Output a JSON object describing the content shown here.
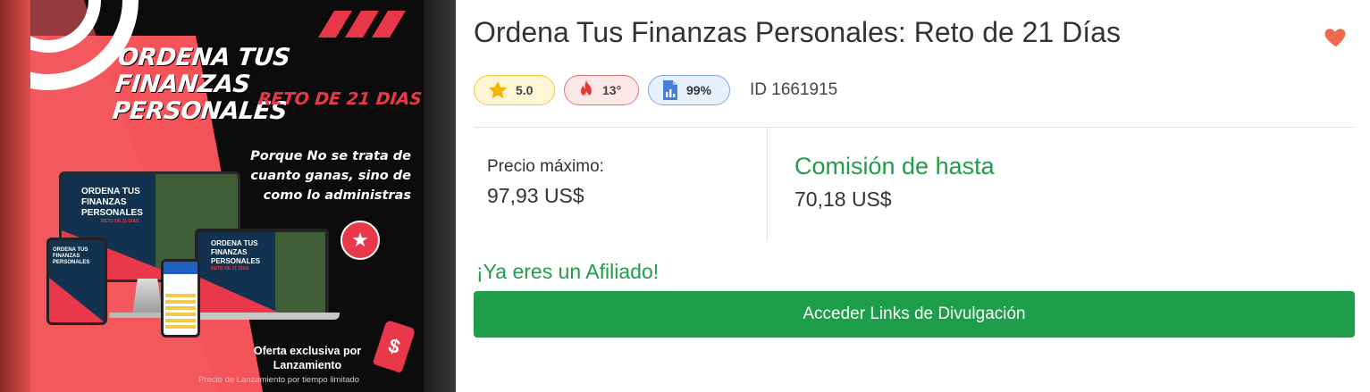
{
  "product_image": {
    "headline": "ORDENA TUS FINANZAS PERSONALES",
    "subheadline": "RETO DE 21 DIAS",
    "tagline": "Porque No se trata de cuanto ganas, sino de como lo administras",
    "monitor_text": "ORDENA TUS FINANZAS PERSONALES",
    "monitor_subtext": "RETO DE 21 DIAS",
    "laptop_text": "ORDENA TUS FINANZAS PERSONALES",
    "laptop_subtext": "RETO DE 21 DIAS",
    "tablet_text": "ORDENA TUS FINANZAS PERSONALES",
    "offer": "Oferta exclusiva por Lanzamiento",
    "fineprint": "Precio de Lanzamiento por tiempo limitado",
    "price_tag_symbol": "$",
    "accent_color": "#e8384a"
  },
  "product": {
    "title": "Ordena Tus Finanzas Personales: Reto de 21 Días",
    "favorite_icon": "heart-icon",
    "favorite_color": "#ee6a4c"
  },
  "badges": {
    "rating": "5.0",
    "temperature": "13°",
    "score": "99%",
    "id_label": "ID 1661915"
  },
  "pricing": {
    "max_price_label": "Precio máximo:",
    "max_price_value": "97,93 US$",
    "commission_label": "Comisión de hasta",
    "commission_value": "70,18 US$"
  },
  "affiliate": {
    "status": "¡Ya eres un Afiliado!",
    "button_label": "Acceder Links de Divulgación",
    "accent_color": "#1e9e4a"
  }
}
